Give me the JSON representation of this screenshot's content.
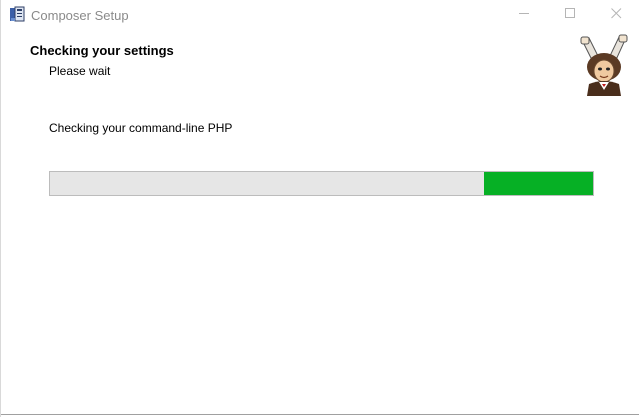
{
  "window": {
    "title": "Composer Setup"
  },
  "header": {
    "heading": "Checking your settings",
    "subheading": "Please wait"
  },
  "main": {
    "status_text": "Checking your command-line PHP"
  },
  "progress": {
    "fraction": 0.2,
    "fill_color": "#06b025",
    "track_color": "#e6e6e6",
    "fill_side": "right"
  },
  "icons": {
    "app": "composer-app-icon",
    "logo": "composer-conductor-logo",
    "minimize": "minimize-icon",
    "maximize": "maximize-icon",
    "close": "close-icon"
  }
}
